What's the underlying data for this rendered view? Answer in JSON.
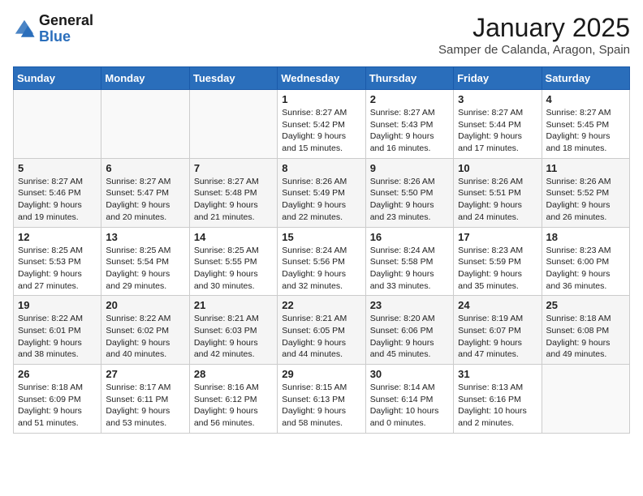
{
  "header": {
    "logo_general": "General",
    "logo_blue": "Blue",
    "month_year": "January 2025",
    "location": "Samper de Calanda, Aragon, Spain"
  },
  "weekdays": [
    "Sunday",
    "Monday",
    "Tuesday",
    "Wednesday",
    "Thursday",
    "Friday",
    "Saturday"
  ],
  "weeks": [
    [
      {
        "day": "",
        "sunrise": "",
        "sunset": "",
        "daylight": ""
      },
      {
        "day": "",
        "sunrise": "",
        "sunset": "",
        "daylight": ""
      },
      {
        "day": "",
        "sunrise": "",
        "sunset": "",
        "daylight": ""
      },
      {
        "day": "1",
        "sunrise": "Sunrise: 8:27 AM",
        "sunset": "Sunset: 5:42 PM",
        "daylight": "Daylight: 9 hours and 15 minutes."
      },
      {
        "day": "2",
        "sunrise": "Sunrise: 8:27 AM",
        "sunset": "Sunset: 5:43 PM",
        "daylight": "Daylight: 9 hours and 16 minutes."
      },
      {
        "day": "3",
        "sunrise": "Sunrise: 8:27 AM",
        "sunset": "Sunset: 5:44 PM",
        "daylight": "Daylight: 9 hours and 17 minutes."
      },
      {
        "day": "4",
        "sunrise": "Sunrise: 8:27 AM",
        "sunset": "Sunset: 5:45 PM",
        "daylight": "Daylight: 9 hours and 18 minutes."
      }
    ],
    [
      {
        "day": "5",
        "sunrise": "Sunrise: 8:27 AM",
        "sunset": "Sunset: 5:46 PM",
        "daylight": "Daylight: 9 hours and 19 minutes."
      },
      {
        "day": "6",
        "sunrise": "Sunrise: 8:27 AM",
        "sunset": "Sunset: 5:47 PM",
        "daylight": "Daylight: 9 hours and 20 minutes."
      },
      {
        "day": "7",
        "sunrise": "Sunrise: 8:27 AM",
        "sunset": "Sunset: 5:48 PM",
        "daylight": "Daylight: 9 hours and 21 minutes."
      },
      {
        "day": "8",
        "sunrise": "Sunrise: 8:26 AM",
        "sunset": "Sunset: 5:49 PM",
        "daylight": "Daylight: 9 hours and 22 minutes."
      },
      {
        "day": "9",
        "sunrise": "Sunrise: 8:26 AM",
        "sunset": "Sunset: 5:50 PM",
        "daylight": "Daylight: 9 hours and 23 minutes."
      },
      {
        "day": "10",
        "sunrise": "Sunrise: 8:26 AM",
        "sunset": "Sunset: 5:51 PM",
        "daylight": "Daylight: 9 hours and 24 minutes."
      },
      {
        "day": "11",
        "sunrise": "Sunrise: 8:26 AM",
        "sunset": "Sunset: 5:52 PM",
        "daylight": "Daylight: 9 hours and 26 minutes."
      }
    ],
    [
      {
        "day": "12",
        "sunrise": "Sunrise: 8:25 AM",
        "sunset": "Sunset: 5:53 PM",
        "daylight": "Daylight: 9 hours and 27 minutes."
      },
      {
        "day": "13",
        "sunrise": "Sunrise: 8:25 AM",
        "sunset": "Sunset: 5:54 PM",
        "daylight": "Daylight: 9 hours and 29 minutes."
      },
      {
        "day": "14",
        "sunrise": "Sunrise: 8:25 AM",
        "sunset": "Sunset: 5:55 PM",
        "daylight": "Daylight: 9 hours and 30 minutes."
      },
      {
        "day": "15",
        "sunrise": "Sunrise: 8:24 AM",
        "sunset": "Sunset: 5:56 PM",
        "daylight": "Daylight: 9 hours and 32 minutes."
      },
      {
        "day": "16",
        "sunrise": "Sunrise: 8:24 AM",
        "sunset": "Sunset: 5:58 PM",
        "daylight": "Daylight: 9 hours and 33 minutes."
      },
      {
        "day": "17",
        "sunrise": "Sunrise: 8:23 AM",
        "sunset": "Sunset: 5:59 PM",
        "daylight": "Daylight: 9 hours and 35 minutes."
      },
      {
        "day": "18",
        "sunrise": "Sunrise: 8:23 AM",
        "sunset": "Sunset: 6:00 PM",
        "daylight": "Daylight: 9 hours and 36 minutes."
      }
    ],
    [
      {
        "day": "19",
        "sunrise": "Sunrise: 8:22 AM",
        "sunset": "Sunset: 6:01 PM",
        "daylight": "Daylight: 9 hours and 38 minutes."
      },
      {
        "day": "20",
        "sunrise": "Sunrise: 8:22 AM",
        "sunset": "Sunset: 6:02 PM",
        "daylight": "Daylight: 9 hours and 40 minutes."
      },
      {
        "day": "21",
        "sunrise": "Sunrise: 8:21 AM",
        "sunset": "Sunset: 6:03 PM",
        "daylight": "Daylight: 9 hours and 42 minutes."
      },
      {
        "day": "22",
        "sunrise": "Sunrise: 8:21 AM",
        "sunset": "Sunset: 6:05 PM",
        "daylight": "Daylight: 9 hours and 44 minutes."
      },
      {
        "day": "23",
        "sunrise": "Sunrise: 8:20 AM",
        "sunset": "Sunset: 6:06 PM",
        "daylight": "Daylight: 9 hours and 45 minutes."
      },
      {
        "day": "24",
        "sunrise": "Sunrise: 8:19 AM",
        "sunset": "Sunset: 6:07 PM",
        "daylight": "Daylight: 9 hours and 47 minutes."
      },
      {
        "day": "25",
        "sunrise": "Sunrise: 8:18 AM",
        "sunset": "Sunset: 6:08 PM",
        "daylight": "Daylight: 9 hours and 49 minutes."
      }
    ],
    [
      {
        "day": "26",
        "sunrise": "Sunrise: 8:18 AM",
        "sunset": "Sunset: 6:09 PM",
        "daylight": "Daylight: 9 hours and 51 minutes."
      },
      {
        "day": "27",
        "sunrise": "Sunrise: 8:17 AM",
        "sunset": "Sunset: 6:11 PM",
        "daylight": "Daylight: 9 hours and 53 minutes."
      },
      {
        "day": "28",
        "sunrise": "Sunrise: 8:16 AM",
        "sunset": "Sunset: 6:12 PM",
        "daylight": "Daylight: 9 hours and 56 minutes."
      },
      {
        "day": "29",
        "sunrise": "Sunrise: 8:15 AM",
        "sunset": "Sunset: 6:13 PM",
        "daylight": "Daylight: 9 hours and 58 minutes."
      },
      {
        "day": "30",
        "sunrise": "Sunrise: 8:14 AM",
        "sunset": "Sunset: 6:14 PM",
        "daylight": "Daylight: 10 hours and 0 minutes."
      },
      {
        "day": "31",
        "sunrise": "Sunrise: 8:13 AM",
        "sunset": "Sunset: 6:16 PM",
        "daylight": "Daylight: 10 hours and 2 minutes."
      },
      {
        "day": "",
        "sunrise": "",
        "sunset": "",
        "daylight": ""
      }
    ]
  ]
}
